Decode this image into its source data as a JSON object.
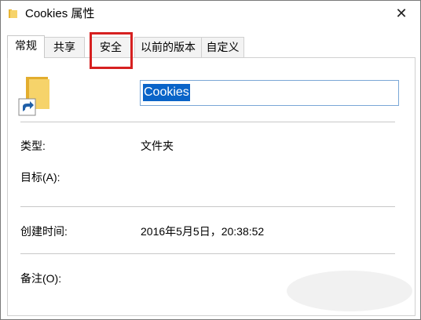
{
  "window": {
    "title": "Cookies 属性",
    "close_glyph": "✕"
  },
  "tabs": [
    {
      "label": "常规",
      "active": true
    },
    {
      "label": "共享",
      "active": false
    },
    {
      "label": "安全",
      "active": false,
      "highlighted": true
    },
    {
      "label": "以前的版本",
      "active": false
    },
    {
      "label": "自定义",
      "active": false
    }
  ],
  "general": {
    "folder_icon": "folder-shortcut-icon",
    "name_value": "Cookies",
    "type_label": "类型:",
    "type_value": "文件夹",
    "target_label": "目标(A):",
    "target_value": "",
    "created_label": "创建时间:",
    "created_value": "2016年5月5日，20:38:52",
    "comment_label": "备注(O):",
    "comment_value": ""
  },
  "colors": {
    "highlight_border": "#d62020",
    "selection": "#0a64c8",
    "folder": "#f2c84b"
  }
}
